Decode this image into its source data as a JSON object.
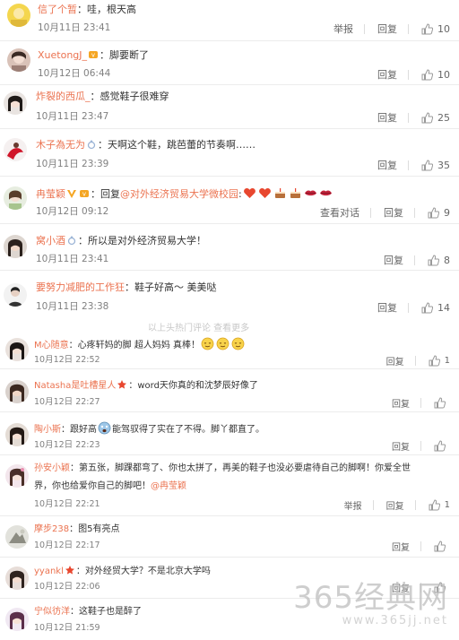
{
  "comments": [
    {
      "user": "信了个暂",
      "text": "：哇，根天高",
      "time": "10月11日 23:41",
      "report": "举报",
      "reply": "回复",
      "likes": "10"
    },
    {
      "user": "XuetongJ_",
      "text": "：脚要断了",
      "time": "10月12日 06:44",
      "reply": "回复",
      "likes": "10"
    },
    {
      "user": "炸裂的西瓜_",
      "text": "：感觉鞋子很难穿",
      "time": "10月11日 23:47",
      "reply": "回复",
      "likes": "25"
    },
    {
      "user": "木子為无为",
      "text": "：天啊这个鞋，跳芭蕾的节奏啊……",
      "time": "10月11日 23:39",
      "reply": "回复",
      "likes": "35"
    },
    {
      "user": "冉莹颖",
      "text_prefix": "：回复",
      "mention": "@对外经济贸易大学微校园",
      "text_suffix": ":",
      "time": "10月12日 09:12",
      "view_conversation": "查看对话",
      "reply": "回复",
      "likes": "9"
    },
    {
      "user": "窝小酒",
      "text": "：所以是对外经济贸易大学！",
      "time": "10月11日 23:41",
      "reply": "回复",
      "likes": "8"
    },
    {
      "user": "要努力减肥的工作狂",
      "text": "：鞋子好高～ 美美哒",
      "time": "10月11日 23:38",
      "reply": "回复",
      "likes": "14"
    },
    {
      "user": "M心随意",
      "text": "：心疼轩妈的脚 超人妈妈 真棒！",
      "time": "10月12日 22:52",
      "reply": "回复",
      "likes": "1"
    },
    {
      "user": "Natasha是吐槽星人",
      "text": "：word天你真的和沈梦辰好像了",
      "time": "10月12日 22:27",
      "reply": "回复",
      "likes": ""
    },
    {
      "user": "陶小斯",
      "text_prefix": "：跟好高",
      "text_suffix": "能驾驭得了实在了不得。脚丫都直了。",
      "time": "10月12日 22:23",
      "reply": "回复",
      "likes": ""
    },
    {
      "user": "孙安小颖",
      "text": "：第五张，脚踝都弯了、你也太拼了，再美的鞋子也没必要虐待自己的脚啊！你爱全世",
      "text2": "界，你也给爱你自己的脚吧！",
      "mention": "@冉莹颖",
      "time": "10月12日 22:21",
      "report": "举报",
      "reply": "回复",
      "likes": "1"
    },
    {
      "user": "摩步238",
      "text": "：图5有亮点",
      "time": "10月12日 22:17",
      "reply": "回复",
      "likes": ""
    },
    {
      "user": "yyankl",
      "text": "：对外经贸大学？不是北京大学吗",
      "time": "10月12日 22:06",
      "reply": "回复",
      "likes": ""
    },
    {
      "user": "宁似彷洋",
      "text": "：这鞋子也是醉了",
      "time": "10月12日 21:59",
      "reply": "回复",
      "likes": ""
    }
  ],
  "divider_text": "以上头热门评论  查看更多",
  "watermark": {
    "main": "365经典网",
    "sub": "www.365jj.net"
  },
  "colors": {
    "username": "#eb7350",
    "time": "#808080",
    "action": "#666666",
    "heart": "#e8472f",
    "lips": "#c4253c"
  }
}
